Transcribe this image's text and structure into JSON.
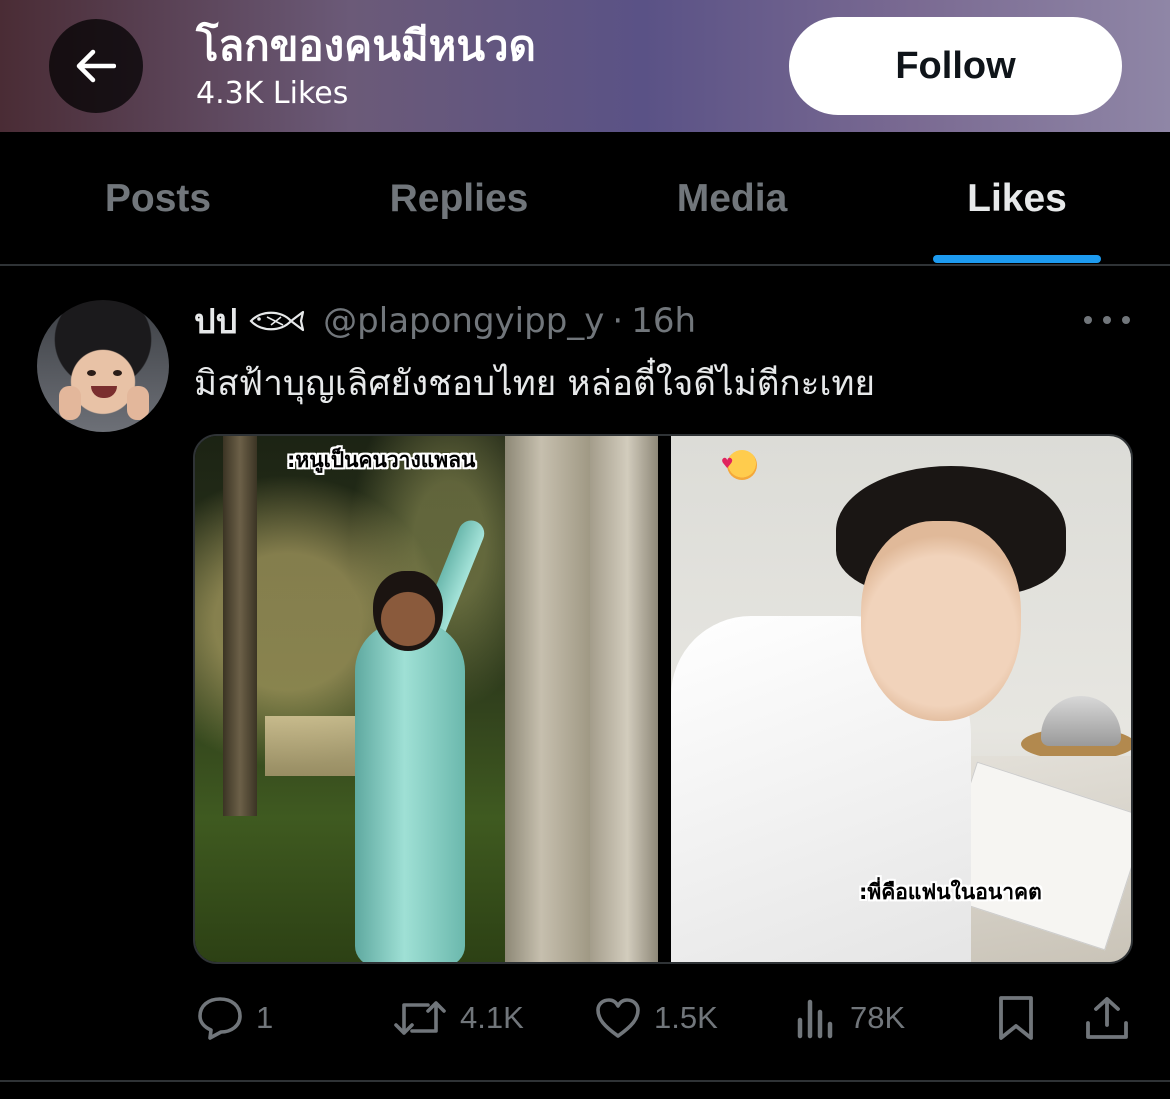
{
  "header": {
    "profile_name": "โลกของคนมีหนวด",
    "likes_count": "4.3K Likes",
    "follow_label": "Follow",
    "back_icon": "arrow-left-icon"
  },
  "tabs": [
    {
      "label": "Posts",
      "active": false
    },
    {
      "label": "Replies",
      "active": false
    },
    {
      "label": "Media",
      "active": false
    },
    {
      "label": "Likes",
      "active": true
    }
  ],
  "post": {
    "author_name": "ปป",
    "author_name_icon": "fish-icon",
    "handle": "@plapongyipp_y",
    "separator": "·",
    "time": "16h",
    "text": "มิสฟ้าบุญเลิศยังชอบไทย หล่อตี๋ใจดีไม่ตีกะเทย",
    "media": {
      "left_caption": ":หนูเป็นคนวางแพลน",
      "right_caption": ":พี่คือแฟนในอนาคต",
      "right_emoji": "smiling-face-with-hearts"
    },
    "actions": {
      "replies": "1",
      "reposts": "4.1K",
      "likes": "1.5K",
      "views": "78K"
    }
  },
  "colors": {
    "accent": "#1d9bf0",
    "background": "#000000",
    "muted_text": "#71767b",
    "primary_text": "#e7e9ea",
    "divider": "#2f3336"
  }
}
